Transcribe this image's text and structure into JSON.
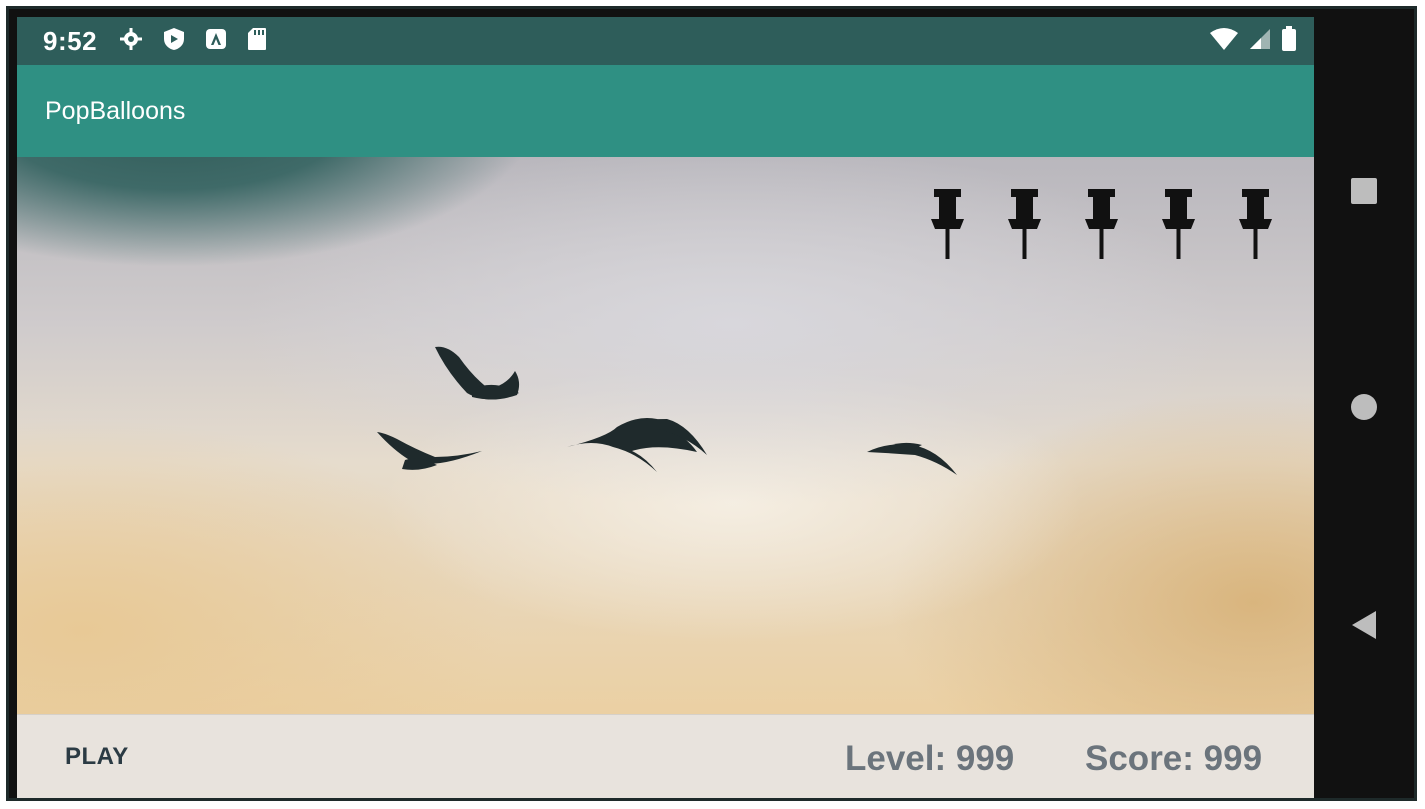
{
  "status_bar": {
    "time": "9:52",
    "left_icons": [
      "settings-icon",
      "shield-icon",
      "app-notification-icon",
      "sd-card-icon"
    ],
    "right_icons": [
      "wifi-icon",
      "signal-icon",
      "battery-icon"
    ]
  },
  "app_bar": {
    "title": "PopBalloons"
  },
  "game": {
    "pins_remaining": 5,
    "pin_icon": "pushpin-icon",
    "background": "sky-with-birds"
  },
  "bottom_bar": {
    "play_label": "PLAY",
    "level_text": "Level: 999",
    "score_text": "Score: 999"
  },
  "nav_bar": {
    "buttons": [
      "recents-button",
      "home-button",
      "back-button"
    ]
  },
  "colors": {
    "status_bar": "#2e5d5a",
    "app_bar": "#2f9083",
    "bottom_bar": "#e8e3dd",
    "nav_bar": "#111111",
    "text_muted": "#6b747c"
  }
}
